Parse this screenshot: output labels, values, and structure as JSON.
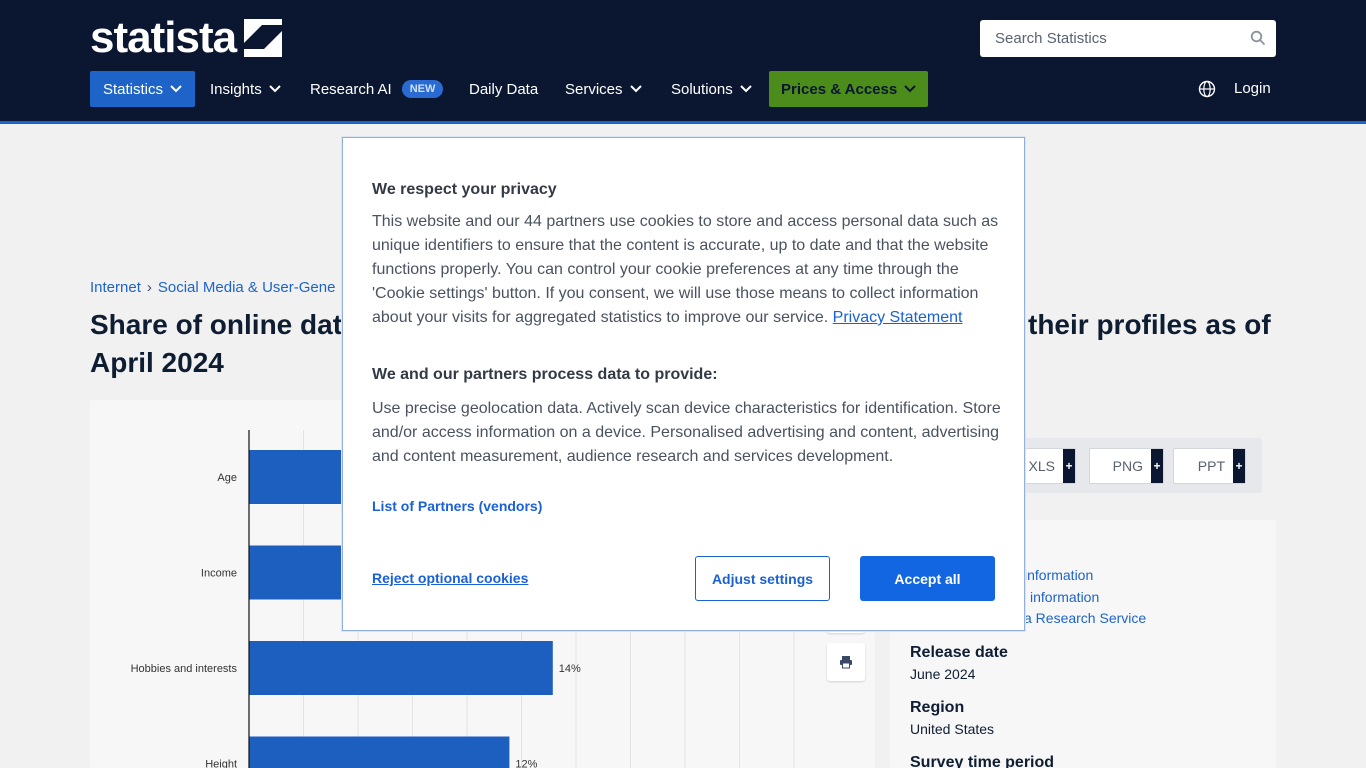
{
  "header": {
    "logo_text": "statista",
    "search_placeholder": "Search Statistics",
    "nav": [
      {
        "label": "Statistics"
      },
      {
        "label": "Insights"
      },
      {
        "label": "Research AI",
        "badge": "NEW"
      },
      {
        "label": "Daily Data"
      },
      {
        "label": "Services"
      },
      {
        "label": "Solutions"
      },
      {
        "label": "Prices & Access"
      }
    ],
    "login": "Login"
  },
  "breadcrumb": [
    "Internet",
    "Social Media & User-Gene"
  ],
  "title": {
    "part1": "Share of online dati",
    "part2": "their profiles as of",
    "part3": "April 2024"
  },
  "chart_data": {
    "type": "bar",
    "orientation": "horizontal",
    "categories": [
      "Age",
      "Income",
      "Hobbies and interests",
      "Height"
    ],
    "values": [
      null,
      null,
      14,
      12
    ],
    "value_labels": [
      "",
      "",
      "14%",
      "12%"
    ],
    "unit": "%"
  },
  "downloads": [
    "XLS",
    "PNG",
    "PPT"
  ],
  "info": {
    "links": [
      "information",
      "information",
      "a Research Service"
    ],
    "release_date_label": "Release date",
    "release_date": "June 2024",
    "region_label": "Region",
    "region": "United States",
    "survey_label": "Survey time period"
  },
  "consent": {
    "title": "We respect your privacy",
    "body": "This website and our 44 partners use cookies to store and access personal data such as unique identifiers to ensure that the content is accurate, up to date and that the website functions properly. You can control your cookie preferences at any time through the 'Cookie settings' button. If you consent, we will use those means to collect information about your visits for aggregated statistics to improve our service.",
    "privacy_link": "Privacy Statement",
    "subtitle": "We and our partners process data to provide:",
    "purposes": "Use precise geolocation data. Actively scan device characteristics for identification. Store and/or access information on a device. Personalised advertising and content, advertising and content measurement, audience research and services development.",
    "vendors_link": "List of Partners (vendors)",
    "reject": "Reject optional cookies",
    "adjust": "Adjust settings",
    "accept": "Accept all"
  },
  "colors": {
    "header_bg": "#0b1731",
    "accent": "#1e64c8",
    "prices_bg": "#4c8c1a",
    "bar": "#1c5fbf",
    "accept_bg": "#1266e2"
  }
}
